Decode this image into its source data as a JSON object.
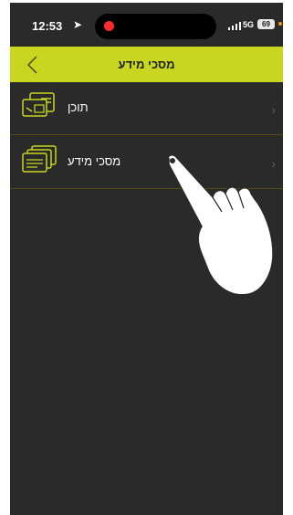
{
  "status_bar": {
    "time": "12:53",
    "network": "5G",
    "battery": "69"
  },
  "header": {
    "title": "מסכי מידע",
    "back_icon": "chevron-left-icon"
  },
  "menu": {
    "items": [
      {
        "label": "תוכן",
        "icon": "content-card-icon"
      },
      {
        "label": "מסכי מידע",
        "icon": "info-screens-icon"
      }
    ]
  },
  "colors": {
    "accent": "#c8d620",
    "background": "#2a2a2a"
  }
}
